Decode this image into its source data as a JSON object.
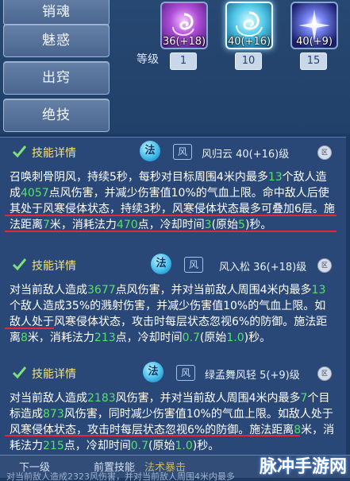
{
  "sidebar": {
    "items": [
      {
        "label": "销魂"
      },
      {
        "label": "魅惑"
      },
      {
        "label": "出窍"
      },
      {
        "label": "绝技"
      }
    ]
  },
  "skill_row": {
    "level_label": "等级",
    "icons": [
      {
        "level_text": "36(+18)",
        "number": "1"
      },
      {
        "level_text": "40(+16)",
        "number": "10"
      },
      {
        "level_text": "40(+9)",
        "number": "15"
      }
    ]
  },
  "sections": [
    {
      "title": "技能详情",
      "fa": "法",
      "feng": "风",
      "name": "风归云 40(+16)级",
      "coin": "区",
      "desc_parts": [
        {
          "t": "召唤刺骨阴风，持续5秒，每秒对目标周围4米内最多",
          "c": ""
        },
        {
          "t": "13",
          "c": "g"
        },
        {
          "t": "个敌人造成",
          "c": ""
        },
        {
          "t": "4057",
          "c": "g"
        },
        {
          "t": "点风伤害，并减少伤害值10%的气血上限。命中敌人后使其处于风寒侵体状态，持续3秒，风寒侵体状态最多可叠加6层。施法距离",
          "c": ""
        },
        {
          "t": "7",
          "c": "g"
        },
        {
          "t": "米，消耗法力",
          "c": ""
        },
        {
          "t": "470",
          "c": "g"
        },
        {
          "t": "点，冷却时间",
          "c": ""
        },
        {
          "t": "3",
          "c": "g"
        },
        {
          "t": "(原始",
          "c": ""
        },
        {
          "t": "5",
          "c": "g"
        },
        {
          "t": ")秒。",
          "c": ""
        }
      ]
    },
    {
      "title": "技能详情",
      "fa": "法",
      "feng": "风",
      "name": "风入松 36(+18)级",
      "coin": "区",
      "desc_parts": [
        {
          "t": "对当前敌人造成",
          "c": ""
        },
        {
          "t": "3677",
          "c": "g"
        },
        {
          "t": "点风伤害，并对当前敌人周围4米内最多",
          "c": ""
        },
        {
          "t": "13",
          "c": "g"
        },
        {
          "t": "个敌人造成35%的溅射伤害，并减少伤害值10%的气血上限。如敌人处于风寒侵体状态，攻击时每层状态忽视6%的防御。施法距离",
          "c": ""
        },
        {
          "t": "8",
          "c": "g"
        },
        {
          "t": "米，消耗法力",
          "c": ""
        },
        {
          "t": "213",
          "c": "g"
        },
        {
          "t": "点，冷却时间",
          "c": ""
        },
        {
          "t": "0.7",
          "c": "g"
        },
        {
          "t": "(原始",
          "c": ""
        },
        {
          "t": "1.0",
          "c": "g"
        },
        {
          "t": ")秒。",
          "c": ""
        }
      ]
    },
    {
      "title": "技能详情",
      "fa": "法",
      "feng": "风",
      "name": "绿孟舞风轻 5(+9)级",
      "coin": "区",
      "desc_parts": [
        {
          "t": "对当前敌人造成",
          "c": ""
        },
        {
          "t": "2183",
          "c": "g"
        },
        {
          "t": "风伤害，并对当前敌人周围4米内最多",
          "c": ""
        },
        {
          "t": "7",
          "c": "g"
        },
        {
          "t": "个目标造成",
          "c": ""
        },
        {
          "t": "873",
          "c": "g"
        },
        {
          "t": "风伤害，同时减少伤害值10%的气血上限。如敌人处于风寒侵体状态，攻击时每层状态忽视6%的防御。施法距离",
          "c": ""
        },
        {
          "t": "8",
          "c": "g"
        },
        {
          "t": "米，消耗法力",
          "c": ""
        },
        {
          "t": "215",
          "c": "g"
        },
        {
          "t": "点，冷却时间",
          "c": ""
        },
        {
          "t": "0.7",
          "c": "g"
        },
        {
          "t": "(原始",
          "c": ""
        },
        {
          "t": "1.0",
          "c": "g"
        },
        {
          "t": ")秒。",
          "c": ""
        }
      ]
    }
  ],
  "bottom": {
    "tabs": [
      {
        "label": "下一级"
      },
      {
        "label": "前置技能"
      }
    ],
    "prereq_value": "法术暴击",
    "overflow_text": "对当前敌人造成2323风伤害，并对当前敌人周围4米内最多",
    "watermark": "脉冲手游网"
  },
  "colors": {
    "highlight": "#55e06a",
    "underline": "#e8263a",
    "title": "#f4e27a"
  }
}
